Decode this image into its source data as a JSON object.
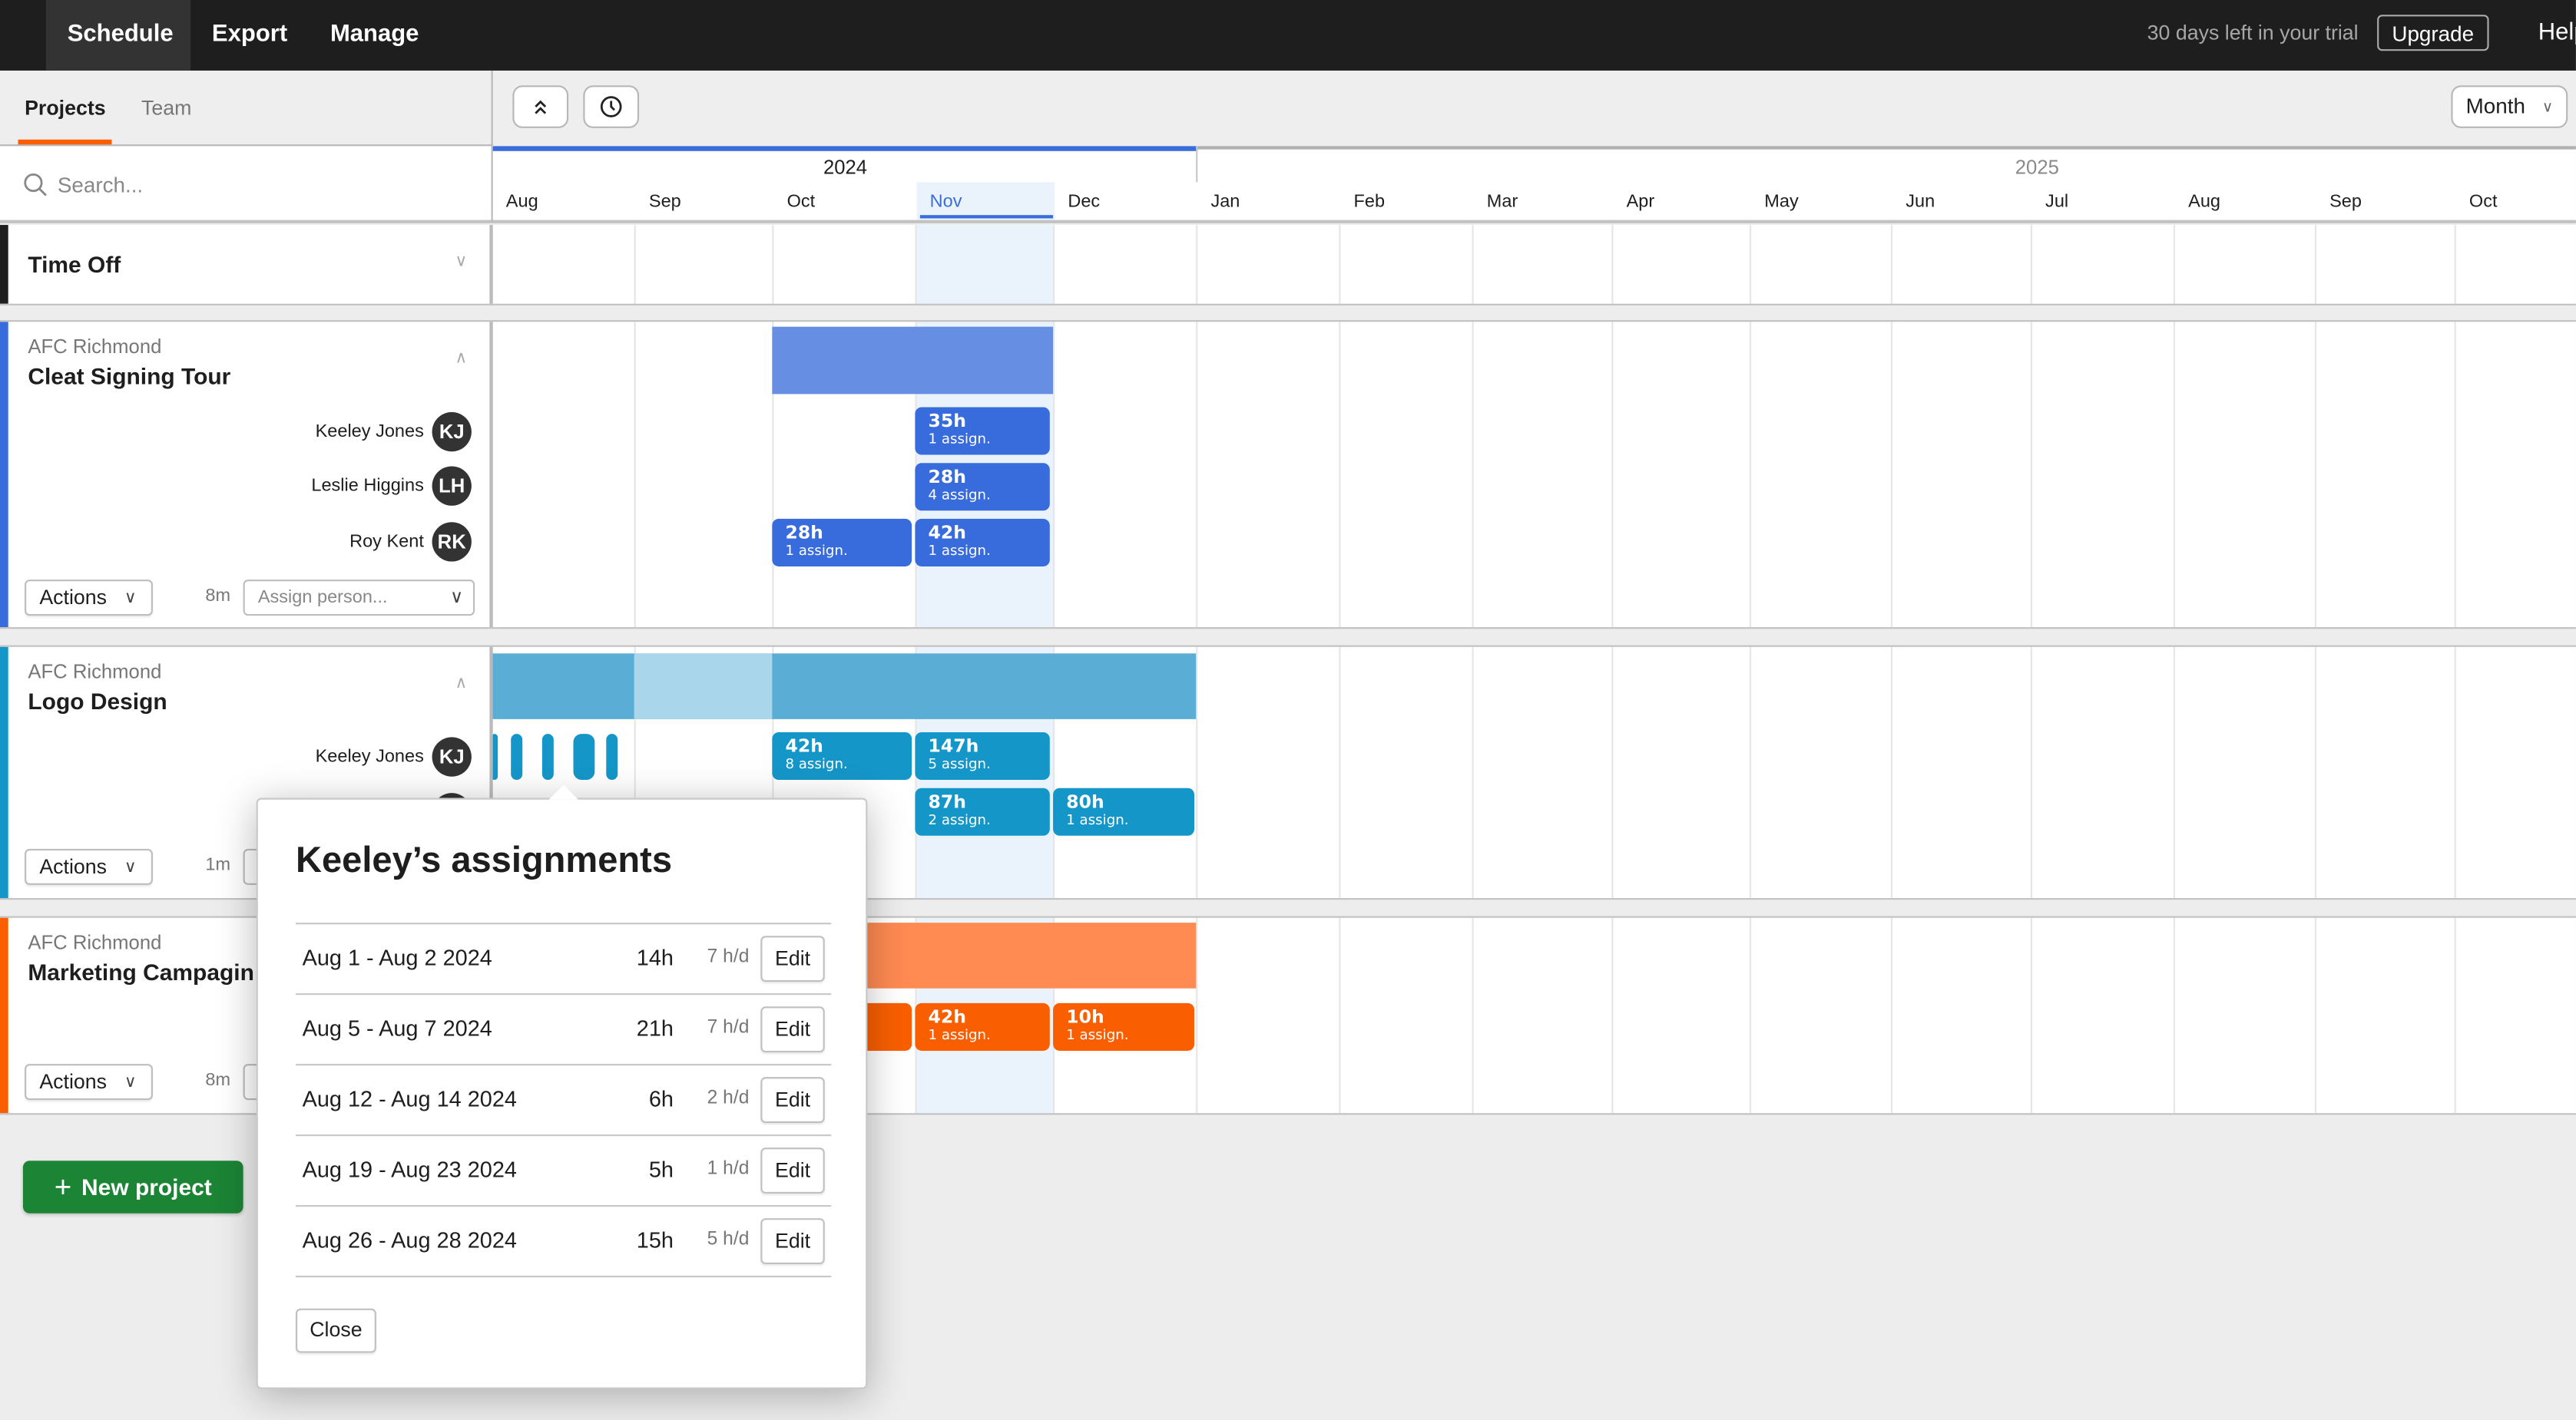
{
  "topbar": {
    "tabs": [
      {
        "label": "Schedule",
        "active": true
      },
      {
        "label": "Export",
        "active": false
      },
      {
        "label": "Manage",
        "active": false
      }
    ],
    "trial_text": "30 days left in your trial",
    "upgrade_label": "Upgrade",
    "help_label": "Help"
  },
  "sidebar": {
    "tabs": [
      {
        "label": "Projects",
        "active": true
      },
      {
        "label": "Team",
        "active": false
      }
    ],
    "search_placeholder": "Search...",
    "search_value": ""
  },
  "toolbar": {
    "collapse_all_icon": "double-chevron-up-icon",
    "history_icon": "clock-icon",
    "view_select": "Month"
  },
  "timeline": {
    "years": [
      {
        "label": "2024",
        "months": [
          "Aug",
          "Sep",
          "Oct",
          "Nov",
          "Dec"
        ]
      },
      {
        "label": "2025",
        "months": [
          "Jan",
          "Feb",
          "Mar",
          "Apr",
          "May",
          "Jun",
          "Jul",
          "Aug",
          "Sep",
          "Oct"
        ]
      }
    ],
    "months": [
      "Aug",
      "Sep",
      "Oct",
      "Nov",
      "Dec",
      "Jan",
      "Feb",
      "Mar",
      "Apr",
      "May",
      "Jun",
      "Jul",
      "Aug",
      "Sep",
      "Oct"
    ],
    "current_month": "Nov",
    "accent_color": "#3a6ddc"
  },
  "time_off": {
    "label": "Time Off"
  },
  "projects": [
    {
      "client": "AFC Richmond",
      "name": "Cleat Signing Tour",
      "color": "#386bdc",
      "bar_color": "#668fe4",
      "duration": "8m",
      "actions_label": "Actions",
      "assign_placeholder": "Assign person...",
      "members": [
        {
          "name": "Keeley Jones",
          "initials": "KJ",
          "chips": [
            {
              "month": "Nov",
              "hours": "35h",
              "assign": "1 assign."
            }
          ]
        },
        {
          "name": "Leslie Higgins",
          "initials": "LH",
          "chips": [
            {
              "month": "Nov",
              "hours": "28h",
              "assign": "4 assign."
            }
          ]
        },
        {
          "name": "Roy Kent",
          "initials": "RK",
          "chips": [
            {
              "month": "Oct",
              "hours": "28h",
              "assign": "1 assign."
            },
            {
              "month": "Nov",
              "hours": "42h",
              "assign": "1 assign."
            }
          ]
        }
      ]
    },
    {
      "client": "AFC Richmond",
      "name": "Logo Design",
      "color": "#1596c8",
      "bar_color": "#5aaed6",
      "duration": "1m",
      "actions_label": "Actions",
      "members": [
        {
          "name": "Keeley Jones",
          "initials": "KJ",
          "chips": [
            {
              "month": "Oct",
              "hours": "42h",
              "assign": "8 assign."
            },
            {
              "month": "Nov",
              "hours": "147h",
              "assign": "5 assign."
            }
          ]
        },
        {
          "name": "",
          "initials": "",
          "chips": [
            {
              "month": "Nov",
              "hours": "87h",
              "assign": "2 assign."
            },
            {
              "month": "Dec",
              "hours": "80h",
              "assign": "1 assign."
            }
          ]
        }
      ]
    },
    {
      "client": "AFC Richmond",
      "name": "Marketing Campagin",
      "color": "#f95f00",
      "bar_color": "#ff8a52",
      "duration": "8m",
      "actions_label": "Actions",
      "members": [
        {
          "chips": [
            {
              "month": "Nov",
              "hours": "42h",
              "assign": "1 assign."
            },
            {
              "month": "Dec",
              "hours": "10h",
              "assign": "1 assign."
            }
          ]
        }
      ]
    }
  ],
  "new_project_label": "New project",
  "popup": {
    "title": "Keeley’s assignments",
    "rows": [
      {
        "range": "Aug 1 - Aug 2 2024",
        "hours": "14h",
        "rate": "7 h/d",
        "edit": "Edit"
      },
      {
        "range": "Aug 5 - Aug 7 2024",
        "hours": "21h",
        "rate": "7 h/d",
        "edit": "Edit"
      },
      {
        "range": "Aug 12 - Aug 14 2024",
        "hours": "6h",
        "rate": "2 h/d",
        "edit": "Edit"
      },
      {
        "range": "Aug 19 - Aug 23 2024",
        "hours": "5h",
        "rate": "1 h/d",
        "edit": "Edit"
      },
      {
        "range": "Aug 26 - Aug 28 2024",
        "hours": "15h",
        "rate": "5 h/d",
        "edit": "Edit"
      }
    ],
    "close_label": "Close"
  }
}
